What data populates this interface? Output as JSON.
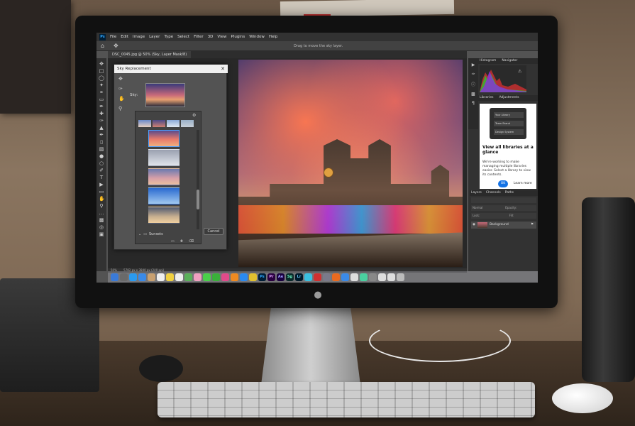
{
  "menu": {
    "items": [
      "File",
      "Edit",
      "Image",
      "Layer",
      "Type",
      "Select",
      "Filter",
      "3D",
      "View",
      "Plugins",
      "Window",
      "Help"
    ]
  },
  "options_bar": {
    "hint": "Drag to move the sky layer."
  },
  "document_tab": {
    "label": "DSC_0045.jpg @ 50% (Sky, Layer Mask/8)"
  },
  "status_bar": {
    "zoom": "50%",
    "doc_info": "5782 px x 3840 px (240 ppi)"
  },
  "dialog": {
    "title": "Sky Replacement",
    "sky_label": "Sky:",
    "cancel_label": "Cancel",
    "folder_label": "Sunsets"
  },
  "panels": {
    "histogram_tab": "Histogram",
    "navigator_tab": "Navigator",
    "libraries_tab": "Libraries",
    "adjustments_tab": "Adjustments",
    "library_preview_items": [
      "Your Library",
      "Team Brand",
      "Design System"
    ],
    "library_heading": "View all libraries at a glance",
    "library_body": "We're working to make managing multiple libraries easier. Select a library to view its contents.",
    "ok_label": "OK",
    "learn_more": "Learn more",
    "layers_tab": "Layers",
    "channels_tab": "Channels",
    "paths_tab": "Paths",
    "blend_mode": "Normal",
    "opacity_label": "Opacity:",
    "lock_label": "Lock:",
    "fill_label": "Fill:",
    "layer_name": "Background"
  },
  "dock": {
    "labeled_icons": [
      "Pr",
      "Ae",
      "Sg",
      "Lr"
    ]
  },
  "colors": {
    "ps_blue": "#31a8ff",
    "panel_dark": "#323232",
    "accent_blue": "#1473e6"
  }
}
